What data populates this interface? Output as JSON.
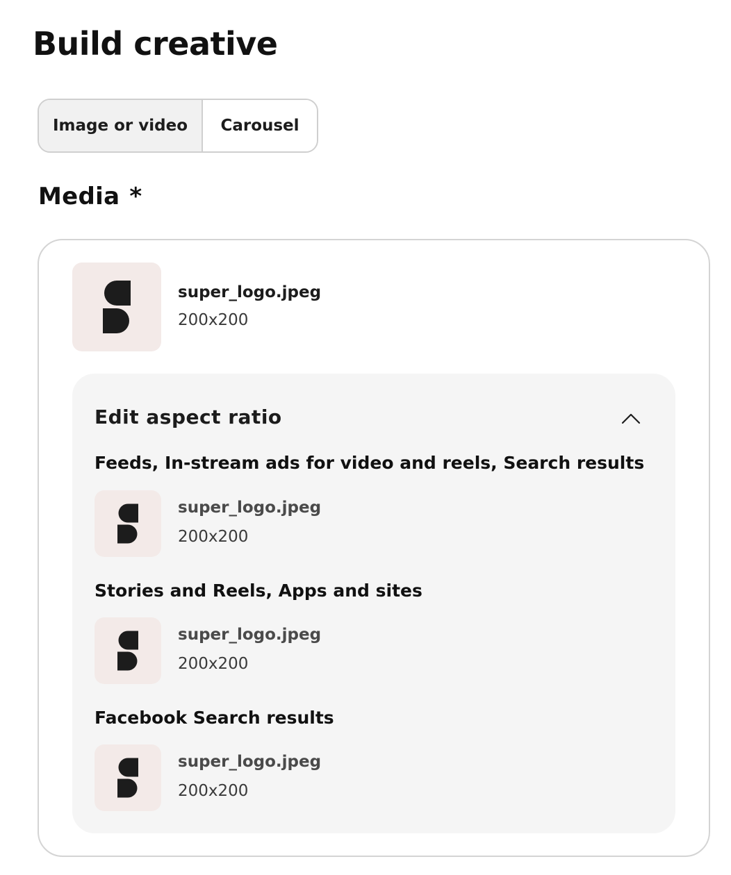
{
  "page": {
    "title": "Build creative"
  },
  "format_selector": {
    "options": [
      "Image or video",
      "Carousel"
    ],
    "selected": "Image or video"
  },
  "media": {
    "label": "Media",
    "required_marker": "*",
    "file": {
      "name": "super_logo.jpeg",
      "dimensions": "200x200",
      "thumbnail_icon": "s-logo-icon"
    },
    "aspect_ratio": {
      "title": "Edit aspect ratio",
      "toggle_icon": "chevron-up-icon",
      "expanded": true,
      "placements": [
        {
          "label": "Feeds, In-stream ads for video and reels, Search results",
          "file_name": "super_logo.jpeg",
          "dimensions": "200x200"
        },
        {
          "label": "Stories and Reels, Apps and sites",
          "file_name": "super_logo.jpeg",
          "dimensions": "200x200"
        },
        {
          "label": "Facebook Search results",
          "file_name": "super_logo.jpeg",
          "dimensions": "200x200"
        }
      ]
    }
  },
  "colors": {
    "thumbnail_background": "#f3eae8",
    "panel_background": "#f5f5f5",
    "selected_segment": "#f1f1f1",
    "border": "#d4d4d4",
    "text": "#1c1c1c"
  }
}
